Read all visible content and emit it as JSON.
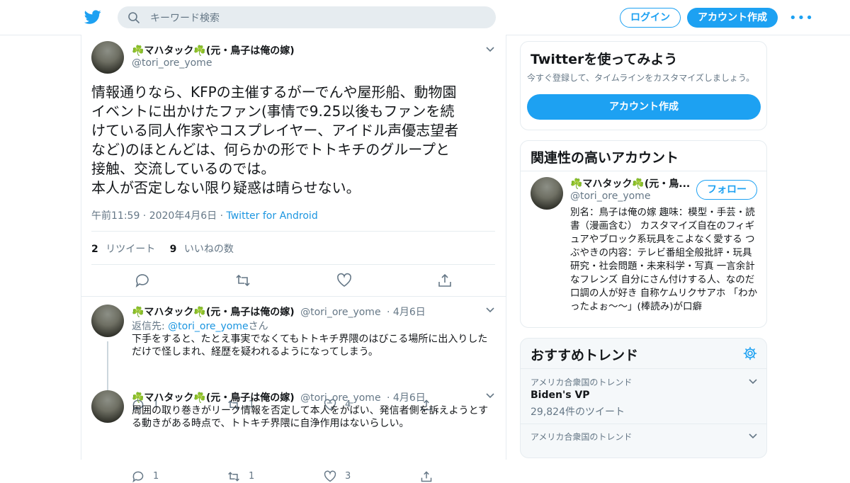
{
  "colors": {
    "accent": "#1da1f2",
    "link": "#1b95e0",
    "muted": "#657786",
    "border": "#e6ecf0",
    "clover": "#4caf50"
  },
  "header": {
    "search_placeholder": "キーワード検索",
    "login_label": "ログイン",
    "signup_label": "アカウント作成",
    "more_label": "•••"
  },
  "main_tweet": {
    "name": "☘️マハタック☘️(元・鳥子は俺の嫁)",
    "handle": "@tori_ore_yome",
    "text": "情報通りなら、KFPの主催するがーでんや屋形船、動物園\nイベントに出かけたファン(事情で9.25以後もファンを続\nけている同人作家やコスプレイヤー、アイドル声優志望者\nなど)のほとんどは、何らかの形でトトキチのグループと\n接触、交流しているのでは。\n本人が否定しない限り疑惑は晴らせない。",
    "time": "午前11:59 · 2020年4月6日 · ",
    "app": "Twitter for Android",
    "retweets": "2",
    "retweets_label": "リツイート",
    "likes": "9",
    "likes_label": "いいねの数"
  },
  "replies": [
    {
      "name": "☘️マハタック☘️(元・鳥子は俺の嫁)",
      "handle": "@tori_ore_yome",
      "date": "· 4月6日",
      "reply_to_prefix": "返信先: ",
      "reply_to_handle": "@tori_ore_yome",
      "reply_to_suffix": "さん",
      "text": "下手をすると、たとえ事実でなくてもトトキチ界隈のはびこる場所に出入りした\nだけで怪しまれ、経歴を疑われるようになってしまう。",
      "replies": "1",
      "retweets": "1",
      "likes": "4"
    },
    {
      "name": "☘️マハタック☘️(元・鳥子は俺の嫁)",
      "handle": "@tori_ore_yome",
      "date": "· 4月6日",
      "text": "周囲の取り巻きがリーク情報を否定して本人をかばい、発信者側を訴えようとす\nる動きがある時点で、トトキチ界隈に自浄作用はないらしい。",
      "replies": "1",
      "retweets": "1",
      "likes": "3"
    }
  ],
  "sidebar": {
    "signup_card": {
      "title": "Twitterを使ってみよう",
      "subtitle": "今すぐ登録して、タイムラインをカスタマイズしましょう。",
      "button": "アカウント作成"
    },
    "related": {
      "title": "関連性の高いアカウント",
      "name": "☘️マハタック☘️(元・鳥...",
      "handle": "@tori_ore_yome",
      "follow": "フォロー",
      "bio": "別名：鳥子は俺の嫁 趣味：模型・手芸・読書（漫画含む） カスタマイズ自在のフィギュアやブロック系玩具をこよなく愛する つぶやきの内容：テレビ番組全般批評・玩具研究・社会問題・未来科学・写真 一言余計なフレンズ 自分にさん付けする人、なのだ口調の人が好き 自称ケムリクサアホ 「わかったよぉ〜〜」(棒読み)が口癖"
    },
    "trends": {
      "title": "おすすめトレンド",
      "items": [
        {
          "category": "アメリカ合衆国のトレンド",
          "name": "Biden's VP",
          "count": "29,824件のツイート"
        },
        {
          "category": "アメリカ合衆国のトレンド",
          "name": "",
          "count": ""
        }
      ]
    }
  }
}
